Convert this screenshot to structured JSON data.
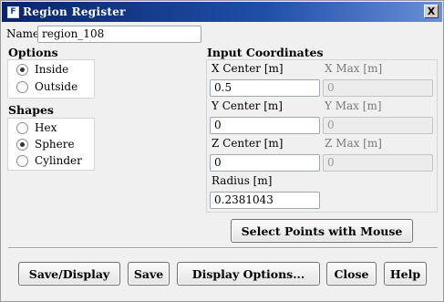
{
  "window": {
    "title": "Region Register",
    "app_icon": "F",
    "close_label": "X"
  },
  "name_field": {
    "label": "Name",
    "value": "region_108"
  },
  "options": {
    "heading": "Options",
    "items": [
      {
        "label": "Inside",
        "checked": true
      },
      {
        "label": "Outside",
        "checked": false
      }
    ]
  },
  "shapes": {
    "heading": "Shapes",
    "items": [
      {
        "label": "Hex",
        "checked": false
      },
      {
        "label": "Sphere",
        "checked": true
      },
      {
        "label": "Cylinder",
        "checked": false
      }
    ]
  },
  "coordinates": {
    "heading": "Input Coordinates",
    "x_center": {
      "label": "X Center [m]",
      "value": "0.5"
    },
    "x_max": {
      "label": "X Max [m]",
      "value": "0"
    },
    "y_center": {
      "label": "Y Center [m]",
      "value": "0"
    },
    "y_max": {
      "label": "Y Max [m]",
      "value": "0"
    },
    "z_center": {
      "label": "Z Center [m]",
      "value": "0"
    },
    "z_max": {
      "label": "Z Max [m]",
      "value": "0"
    },
    "radius": {
      "label": "Radius [m]",
      "value": "0.2381043"
    }
  },
  "select_points_label": "Select Points with Mouse",
  "buttons": {
    "save_display": "Save/Display",
    "save": "Save",
    "display_options": "Display Options...",
    "close": "Close",
    "help": "Help"
  }
}
